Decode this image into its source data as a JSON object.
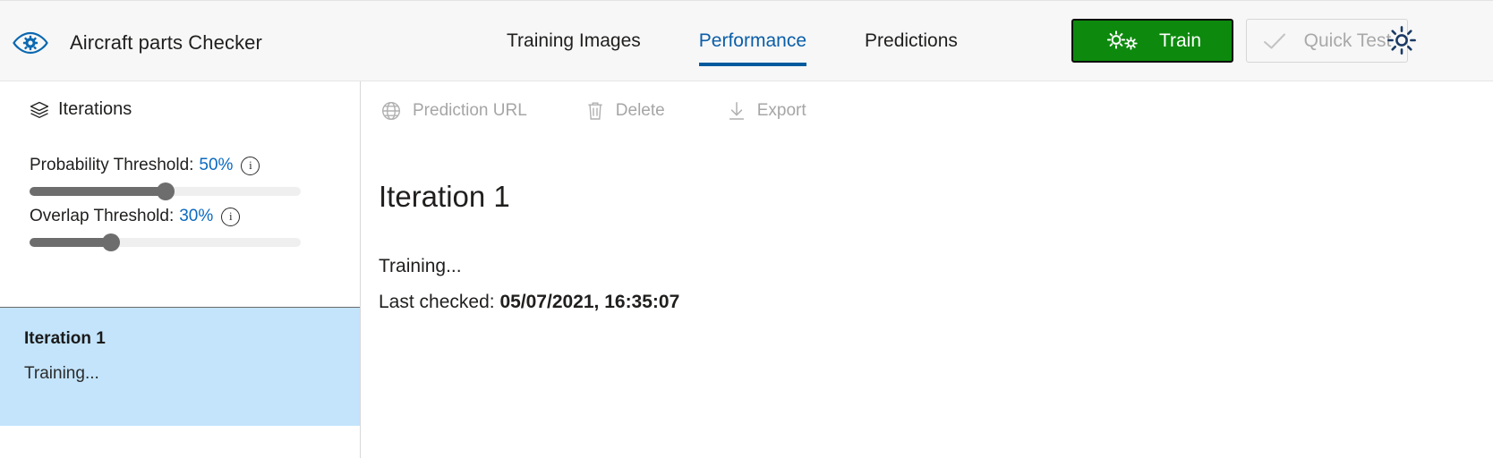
{
  "header": {
    "logo_icon": "eye-gear-logo-icon",
    "title": "Aircraft parts Checker",
    "tabs": [
      {
        "label": "Training Images",
        "active": false
      },
      {
        "label": "Performance",
        "active": true
      },
      {
        "label": "Predictions",
        "active": false
      }
    ],
    "train_button": {
      "label": "Train",
      "icon": "double-gear-icon",
      "background": "#0d8a0d",
      "text_color": "#ffffff",
      "enabled": true
    },
    "quick_test_button": {
      "label": "Quick Test",
      "icon": "checkmark-icon",
      "text_color": "#a9a9a9",
      "enabled": false
    },
    "settings_icon": "gear-icon",
    "accent_color": "#005a9e"
  },
  "sidebar": {
    "heading": {
      "label": "Iterations",
      "icon": "stacked-layers-icon"
    },
    "sliders": [
      {
        "name": "Probability Threshold",
        "label_prefix": "Probability Threshold:",
        "value": "50%",
        "percent": 50,
        "info_icon": "info-icon",
        "info_glyph": "i"
      },
      {
        "name": "Overlap Threshold",
        "label_prefix": "Overlap Threshold:",
        "value": "30%",
        "percent": 30,
        "info_icon": "info-icon",
        "info_glyph": "i"
      }
    ],
    "iterations": [
      {
        "name": "Iteration 1",
        "status": "Training...",
        "selected": true,
        "selected_background": "#c3e4fb"
      }
    ]
  },
  "main": {
    "commands": [
      {
        "label": "Prediction URL",
        "icon": "globe-icon",
        "enabled": false
      },
      {
        "label": "Delete",
        "icon": "trash-icon",
        "enabled": false
      },
      {
        "label": "Export",
        "icon": "download-icon",
        "enabled": false
      }
    ],
    "iteration_title": "Iteration 1",
    "status": "Training...",
    "last_checked_label": "Last checked:",
    "last_checked_value": "05/07/2021, 16:35:07"
  }
}
